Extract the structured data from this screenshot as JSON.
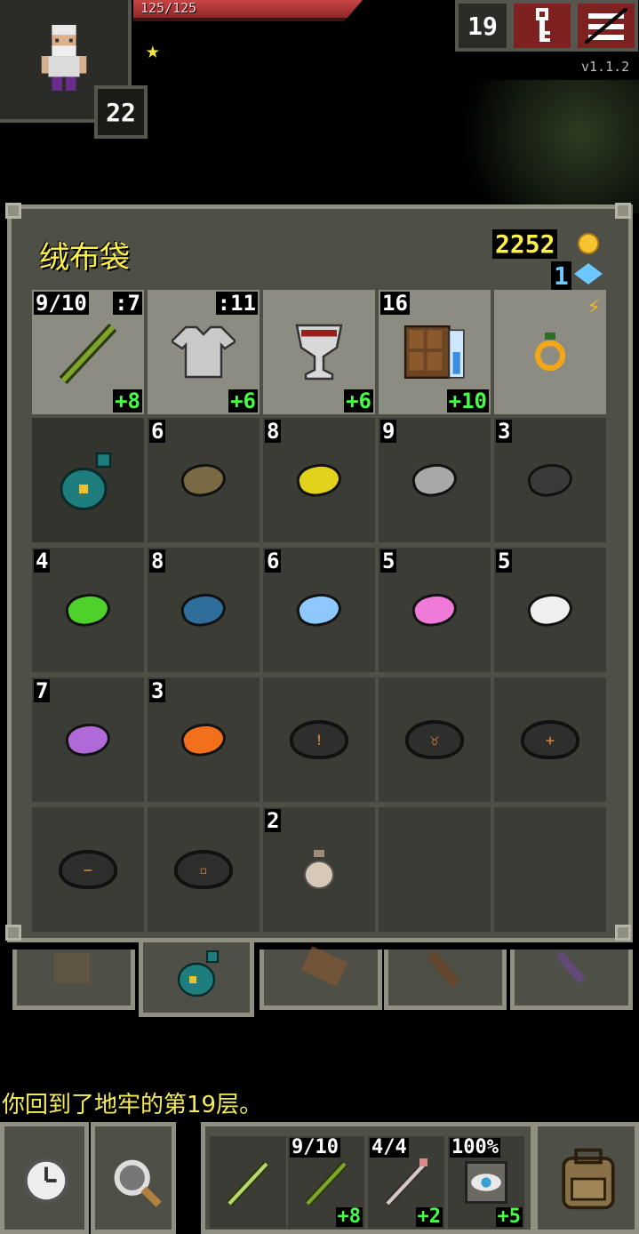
{
  "hud": {
    "hp_text": "125/125",
    "hero_level": "22",
    "depth": "19",
    "version": "v1.1.2",
    "colors": {
      "hp": "#c84444",
      "gold": "#fff04a",
      "gems": "#6cc8ff",
      "upgrade": "#44ff44"
    }
  },
  "bag": {
    "title": "绒布袋",
    "gold": "2252",
    "gems": "1",
    "equipped": [
      {
        "name": "staff-icon",
        "qty_left": "9/10",
        "qty_right": ":7",
        "upgrade": "+8"
      },
      {
        "name": "armor-icon",
        "qty_left": "",
        "qty_right": ":11",
        "upgrade": "+6"
      },
      {
        "name": "artifact-chalice-icon",
        "qty_left": "",
        "qty_right": "",
        "upgrade": "+6"
      },
      {
        "name": "spellbook-icon",
        "qty_left": "16",
        "qty_right": "",
        "upgrade": "+10"
      },
      {
        "name": "ring-icon",
        "qty_left": "",
        "qty_right": "",
        "upgrade": ""
      }
    ],
    "rows": [
      [
        {
          "icon": "velvet-pouch-icon",
          "qty": ""
        },
        {
          "icon": "brown-stone-icon",
          "qty": "6"
        },
        {
          "icon": "yellow-stone-icon",
          "qty": "8"
        },
        {
          "icon": "gray-stone-icon",
          "qty": "9"
        },
        {
          "icon": "black-stone-icon",
          "qty": "3"
        }
      ],
      [
        {
          "icon": "green-stone-icon",
          "qty": "4"
        },
        {
          "icon": "blue-stone-icon",
          "qty": "8"
        },
        {
          "icon": "light-blue-stone-icon",
          "qty": "6"
        },
        {
          "icon": "pink-stone-icon",
          "qty": "5"
        },
        {
          "icon": "white-stone-icon",
          "qty": "5"
        }
      ],
      [
        {
          "icon": "purple-stone-icon",
          "qty": "7"
        },
        {
          "icon": "orange-stone-icon",
          "qty": "3"
        },
        {
          "icon": "rune-stone-icon",
          "qty": ""
        },
        {
          "icon": "rune-stone-icon",
          "qty": ""
        },
        {
          "icon": "rune-stone-icon",
          "qty": ""
        }
      ],
      [
        {
          "icon": "rune-stone-icon",
          "qty": ""
        },
        {
          "icon": "rune-stone-icon",
          "qty": ""
        },
        {
          "icon": "seed-pouch-icon",
          "qty": "2"
        },
        {
          "icon": "",
          "qty": ""
        },
        {
          "icon": "",
          "qty": ""
        }
      ]
    ],
    "tabs": [
      "backpack-tab",
      "velvet-pouch-tab",
      "scroll-holder-tab",
      "wand-holster-tab",
      "potion-tab"
    ]
  },
  "log": {
    "message": "你回到了地牢的第19层。"
  },
  "toolbar": {
    "quickslots": [
      {
        "qty": "",
        "upgrade": ""
      },
      {
        "qty": "9/10",
        "upgrade": "+8"
      },
      {
        "qty": "4/4",
        "upgrade": "+2"
      },
      {
        "qty": "100%",
        "upgrade": "+5"
      }
    ]
  }
}
